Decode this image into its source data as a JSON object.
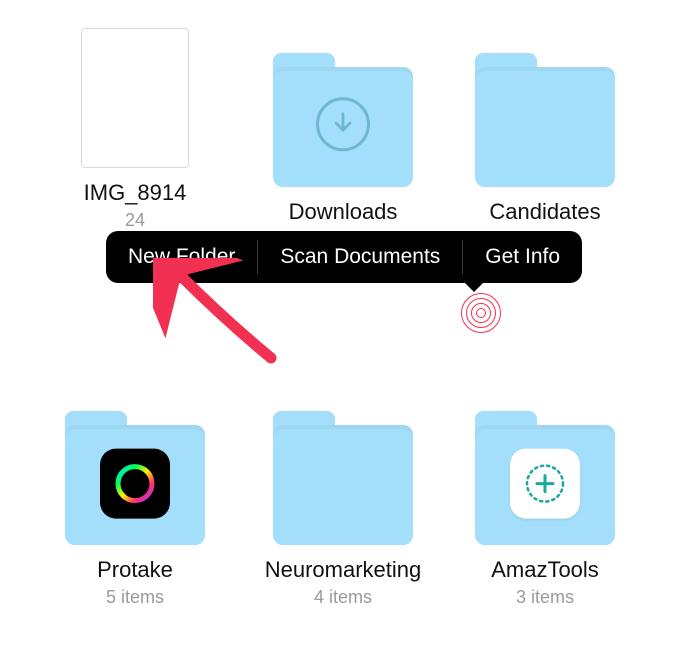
{
  "grid": {
    "items": [
      {
        "name": "IMG_8914",
        "sub": "24",
        "type": "file"
      },
      {
        "name": "Downloads",
        "sub": "",
        "type": "folder",
        "badge": "download"
      },
      {
        "name": "Candidates",
        "sub": "",
        "type": "folder"
      },
      {
        "name": "Protake",
        "sub": "5 items",
        "type": "folder",
        "badge": "protake"
      },
      {
        "name": "Neuromarketing",
        "sub": "4 items",
        "type": "folder"
      },
      {
        "name": "AmazTools",
        "sub": "3 items",
        "type": "folder",
        "badge": "amaz"
      }
    ]
  },
  "context_menu": {
    "items": [
      {
        "label": "New Folder"
      },
      {
        "label": "Scan Documents"
      },
      {
        "label": "Get Info"
      }
    ]
  },
  "colors": {
    "folder": "#a3defa",
    "accent_red": "#f23051"
  }
}
